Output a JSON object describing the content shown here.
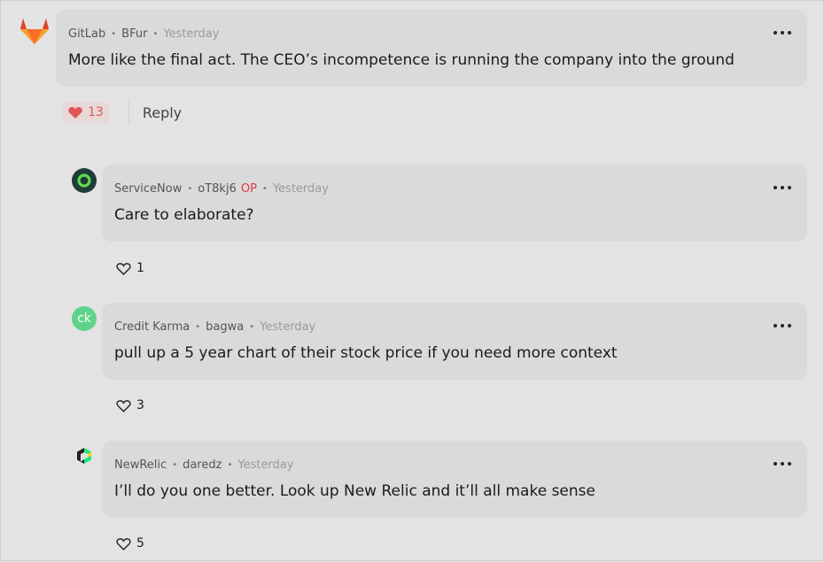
{
  "comments": [
    {
      "company": "GitLab",
      "user": "BFur",
      "time": "Yesterday",
      "text": "More like the final act. The CEO’s incompetence is running the company into the ground",
      "likes": "13",
      "reply_label": "Reply",
      "avatar_icon": "gitlab-logo-icon",
      "liked": true
    },
    {
      "company": "ServiceNow",
      "user": "oT8kj6",
      "op_badge": "OP",
      "time": "Yesterday",
      "text": "Care to elaborate?",
      "likes": "1",
      "avatar_icon": "servicenow-logo-icon"
    },
    {
      "company": "Credit Karma",
      "user": "bagwa",
      "time": "Yesterday",
      "text": "pull up a 5 year chart of their stock price if you need more context",
      "likes": "3",
      "avatar_text": "ck",
      "avatar_icon": "creditkarma-logo-icon"
    },
    {
      "company": "NewRelic",
      "user": "daredz",
      "time": "Yesterday",
      "text": "I’ll do you one better. Look up New Relic and it’ll all make sense",
      "likes": "5",
      "avatar_icon": "newrelic-logo-icon"
    }
  ],
  "colors": {
    "background": "#e3e3e3",
    "bubble": "#dadada",
    "op": "#e03a3a",
    "liked_heart": "#e05555",
    "gitlab_orange": "#fc6d26",
    "servicenow_dark": "#1f3b3a",
    "servicenow_green": "#62d84e",
    "creditkarma_green": "#5fd38a"
  }
}
